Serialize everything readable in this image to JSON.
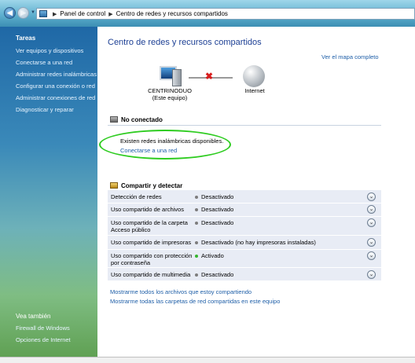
{
  "address_bar": {
    "crumbs": [
      "Panel de control",
      "Centro de redes y recursos compartidos"
    ]
  },
  "sidebar": {
    "tasks_title": "Tareas",
    "tasks": [
      "Ver equipos y dispositivos",
      "Conectarse a una red",
      "Administrar redes inalámbricas",
      "Configurar una conexión o red",
      "Administrar conexiones de red",
      "Diagnosticar y reparar"
    ],
    "see_also_title": "Vea también",
    "see_also": [
      "Firewall de Windows",
      "Opciones de Internet"
    ]
  },
  "main": {
    "title": "Centro de redes y recursos compartidos",
    "map_link": "Ver el mapa completo",
    "computer_name": "CENTRINODUO",
    "computer_sub": "(Este equipo)",
    "internet_label": "Internet",
    "status_title": "No conectado",
    "wireless_text": "Existen redes inalámbricas disponibles.",
    "connect_link": "Conectarse a una red",
    "sharing_title": "Compartir y detectar",
    "sharing_rows": [
      {
        "label": "Detección de redes",
        "status": "Desactivado",
        "active": false
      },
      {
        "label": "Uso compartido de archivos",
        "status": "Desactivado",
        "active": false
      },
      {
        "label": "Uso compartido de la carpeta Acceso público",
        "status": "Desactivado",
        "active": false
      },
      {
        "label": "Uso compartido de impresoras",
        "status": "Desactivado (no hay impresoras instaladas)",
        "active": false
      },
      {
        "label": "Uso compartido con protección por contraseña",
        "status": "Activado",
        "active": true
      },
      {
        "label": "Uso compartido de multimedia",
        "status": "Desactivado",
        "active": false
      }
    ],
    "bottom_links": [
      "Mostrarme todos los archivos que estoy compartiendo",
      "Mostrarme todas las carpetas de red compartidas en este equipo"
    ]
  }
}
